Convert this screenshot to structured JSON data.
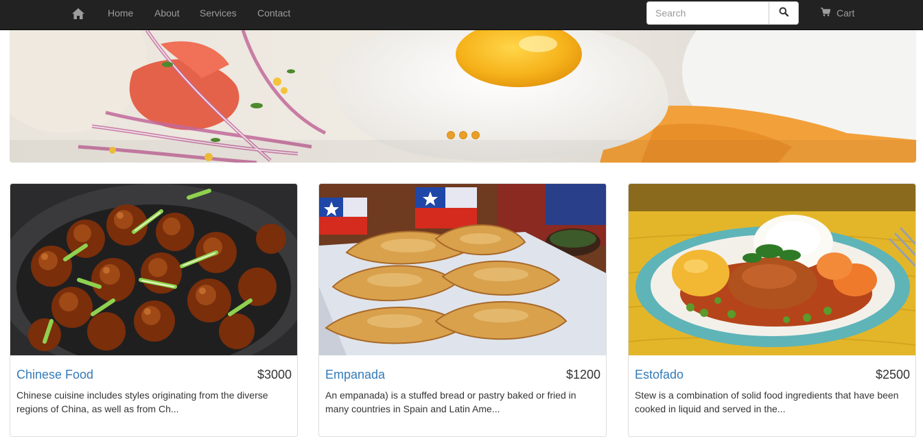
{
  "nav": {
    "home_icon": "home-icon",
    "links": [
      "Home",
      "About",
      "Services",
      "Contact"
    ],
    "search_placeholder": "Search",
    "search_icon": "search-icon",
    "cart_icon": "cart-icon",
    "cart_label": "Cart"
  },
  "carousel": {
    "slide_count": 3,
    "indicator_color": "#e8a02a"
  },
  "products": [
    {
      "title": "Chinese Food",
      "price": "$3000",
      "description": "Chinese cuisine includes styles originating from the diverse regions of China, as well as from Ch..."
    },
    {
      "title": "Empanada",
      "price": "$1200",
      "description": "An empanada) is a stuffed bread or pastry baked or fried in many countries in Spain and Latin Ame..."
    },
    {
      "title": "Estofado",
      "price": "$2500",
      "description": "Stew is a combination of solid food ingredients that have been cooked in liquid and served in the..."
    }
  ],
  "colors": {
    "navbar_bg": "#222222",
    "nav_text": "#9d9d9d",
    "link_blue": "#337ab7"
  }
}
